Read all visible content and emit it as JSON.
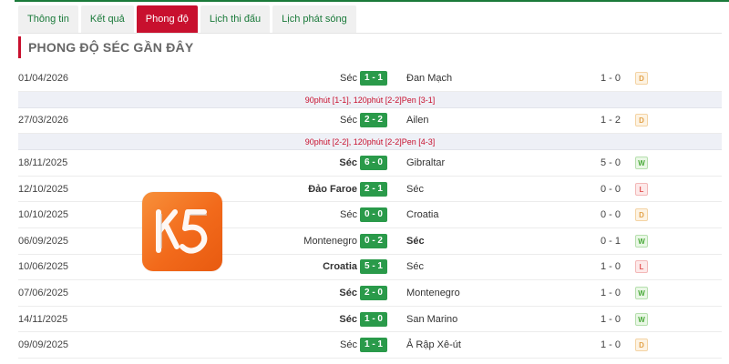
{
  "tabs": [
    {
      "label": "Thông tin",
      "active": false
    },
    {
      "label": "Kết quả",
      "active": false
    },
    {
      "label": "Phong độ",
      "active": true
    },
    {
      "label": "Lịch thi đấu",
      "active": false
    },
    {
      "label": "Lịch phát sóng",
      "active": false
    }
  ],
  "section_title": "PHONG ĐỘ SÉC GẦN ĐÂY",
  "logo": {
    "text": "K5",
    "color": "#f26a1b"
  },
  "colors": {
    "accent": "#c8102e",
    "score": "#2a9a4a",
    "win": "#4aa93a",
    "draw": "#e2a24a",
    "loss": "#e25555"
  },
  "matches": [
    {
      "date": "01/04/2026",
      "home": "Séc",
      "home_bold": false,
      "score": "1 - 1",
      "away": "Đan Mạch",
      "away_bold": false,
      "ht": "1 - 0",
      "result": "D",
      "note": "90phút [1-1], 120phút [2-2]Pen [3-1]"
    },
    {
      "date": "27/03/2026",
      "home": "Séc",
      "home_bold": false,
      "score": "2 - 2",
      "away": "Ailen",
      "away_bold": false,
      "ht": "1 - 2",
      "result": "D",
      "note": "90phút [2-2], 120phút [2-2]Pen [4-3]"
    },
    {
      "date": "18/11/2025",
      "home": "Séc",
      "home_bold": true,
      "score": "6 - 0",
      "away": "Gibraltar",
      "away_bold": false,
      "ht": "5 - 0",
      "result": "W"
    },
    {
      "date": "12/10/2025",
      "home": "Đảo Faroe",
      "home_bold": true,
      "score": "2 - 1",
      "away": "Séc",
      "away_bold": false,
      "ht": "0 - 0",
      "result": "L"
    },
    {
      "date": "10/10/2025",
      "home": "Séc",
      "home_bold": false,
      "score": "0 - 0",
      "away": "Croatia",
      "away_bold": false,
      "ht": "0 - 0",
      "result": "D"
    },
    {
      "date": "06/09/2025",
      "home": "Montenegro",
      "home_bold": false,
      "score": "0 - 2",
      "away": "Séc",
      "away_bold": true,
      "ht": "0 - 1",
      "result": "W"
    },
    {
      "date": "10/06/2025",
      "home": "Croatia",
      "home_bold": true,
      "score": "5 - 1",
      "away": "Séc",
      "away_bold": false,
      "ht": "1 - 0",
      "result": "L"
    },
    {
      "date": "07/06/2025",
      "home": "Séc",
      "home_bold": true,
      "score": "2 - 0",
      "away": "Montenegro",
      "away_bold": false,
      "ht": "1 - 0",
      "result": "W"
    },
    {
      "date": "14/11/2025",
      "home": "Séc",
      "home_bold": true,
      "score": "1 - 0",
      "away": "San Marino",
      "away_bold": false,
      "ht": "1 - 0",
      "result": "W"
    },
    {
      "date": "09/09/2025",
      "home": "Séc",
      "home_bold": false,
      "score": "1 - 1",
      "away": "Ả Rập Xê-út",
      "away_bold": false,
      "ht": "1 - 0",
      "result": "D"
    }
  ]
}
